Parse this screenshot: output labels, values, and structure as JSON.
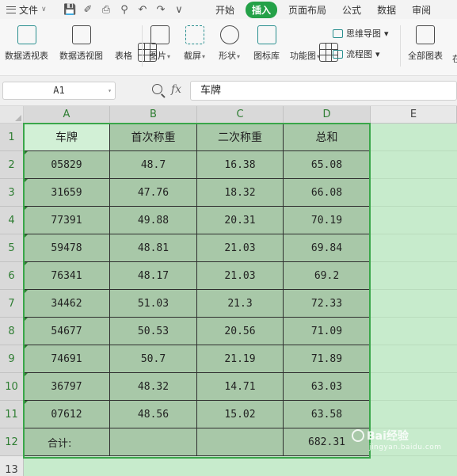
{
  "menubar": {
    "file_label": "文件",
    "tabs": [
      {
        "label": "开始",
        "active": false
      },
      {
        "label": "插入",
        "active": true
      },
      {
        "label": "页面布局",
        "active": false
      },
      {
        "label": "公式",
        "active": false
      },
      {
        "label": "数据",
        "active": false
      },
      {
        "label": "审阅",
        "active": false
      }
    ]
  },
  "ribbon": {
    "items": [
      {
        "label": "数据透视表",
        "icon": "pivot-table-icon"
      },
      {
        "label": "数据透视图",
        "icon": "pivot-chart-icon"
      },
      {
        "label": "表格",
        "icon": "table-icon"
      },
      {
        "label": "图片",
        "icon": "picture-icon",
        "dropdown": true
      },
      {
        "label": "截屏",
        "icon": "screenshot-icon",
        "dropdown": true
      },
      {
        "label": "形状",
        "icon": "shapes-icon",
        "dropdown": true
      },
      {
        "label": "图标库",
        "icon": "icon-library-icon"
      },
      {
        "label": "功能图",
        "icon": "function-chart-icon",
        "dropdown": true
      },
      {
        "label": "全部图表",
        "icon": "all-charts-icon"
      }
    ],
    "small_items": [
      {
        "label": "思维导图",
        "icon": "mind-map-icon",
        "dropdown": true
      },
      {
        "label": "流程图",
        "icon": "flowchart-icon",
        "dropdown": true
      }
    ],
    "truncated_label": "在"
  },
  "formula_bar": {
    "name_box": "A1",
    "fx_label": "fx",
    "content": "车牌"
  },
  "sheet": {
    "columns": [
      "A",
      "B",
      "C",
      "D",
      "E"
    ],
    "row_numbers": [
      "1",
      "2",
      "3",
      "4",
      "5",
      "6",
      "7",
      "8",
      "9",
      "10",
      "11",
      "12",
      "13"
    ],
    "header": [
      "车牌",
      "首次称重",
      "二次称重",
      "总和"
    ],
    "rows": [
      [
        "05829",
        "48.7",
        "16.38",
        "65.08"
      ],
      [
        "31659",
        "47.76",
        "18.32",
        "66.08"
      ],
      [
        "77391",
        "49.88",
        "20.31",
        "70.19"
      ],
      [
        "59478",
        "48.81",
        "21.03",
        "69.84"
      ],
      [
        "76341",
        "48.17",
        "21.03",
        "69.2"
      ],
      [
        "34462",
        "51.03",
        "21.3",
        "72.33"
      ],
      [
        "54677",
        "50.53",
        "20.56",
        "71.09"
      ],
      [
        "74691",
        "50.7",
        "21.19",
        "71.89"
      ],
      [
        "36797",
        "48.32",
        "14.71",
        "63.03"
      ],
      [
        "07612",
        "48.56",
        "15.02",
        "63.58"
      ]
    ],
    "total_row": [
      "合计:",
      "",
      "",
      "682.31"
    ]
  },
  "watermark": {
    "text": "Bai经验",
    "sub": "jingyan.baidu.com"
  }
}
